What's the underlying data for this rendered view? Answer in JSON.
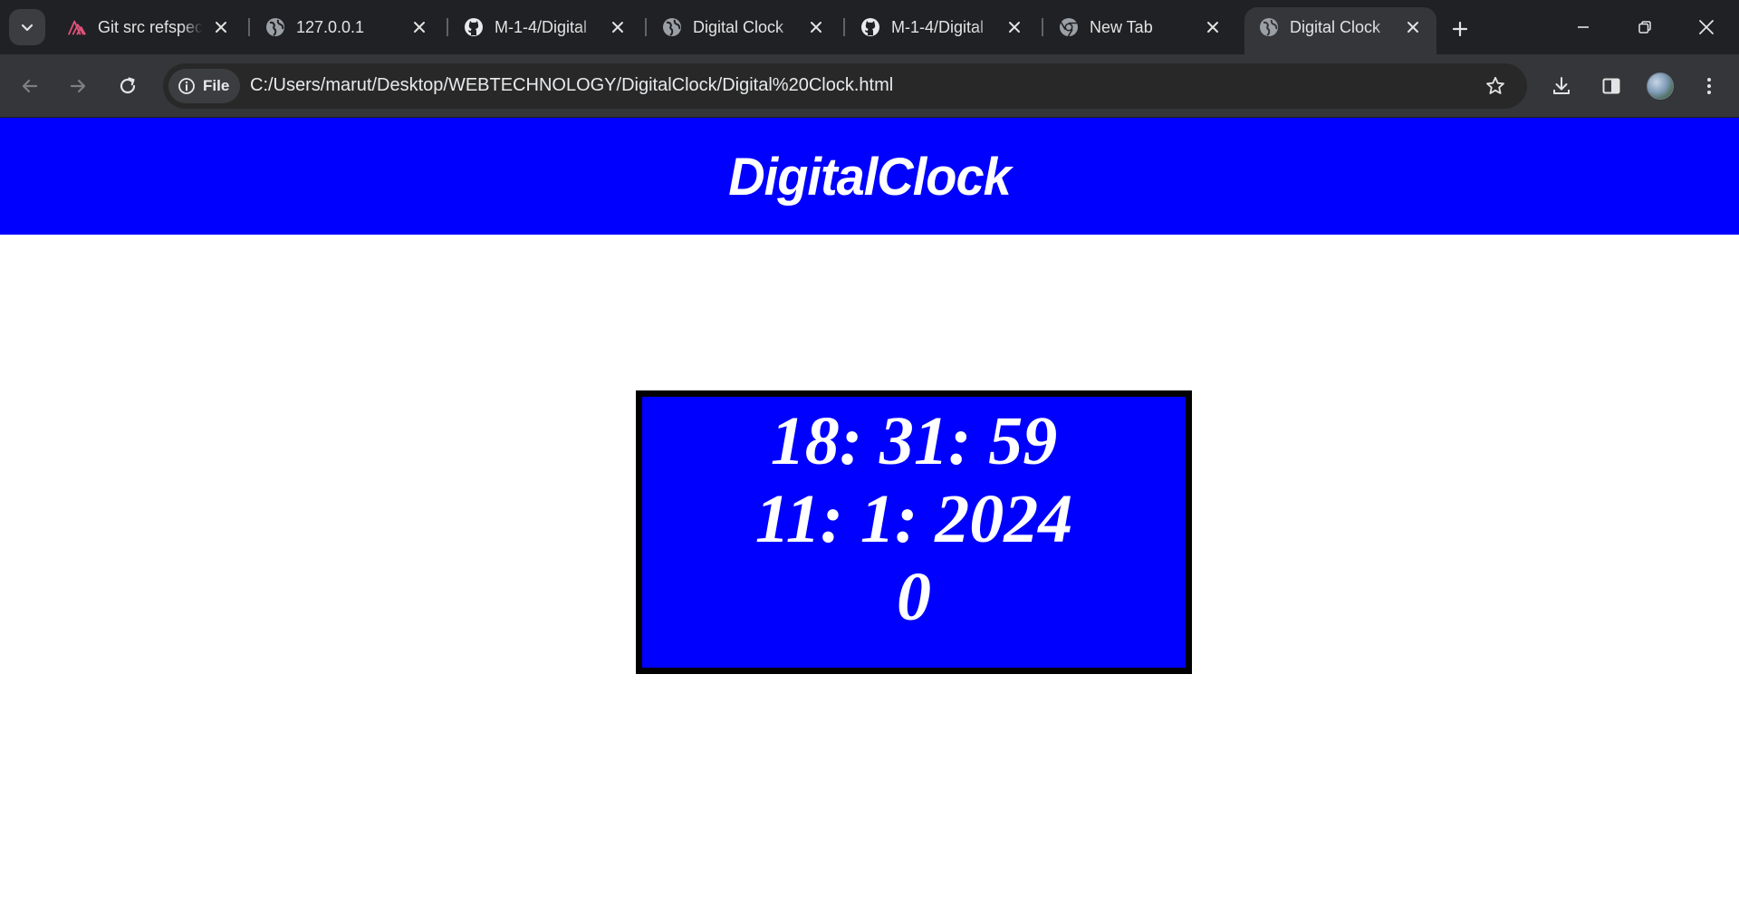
{
  "browser": {
    "tabs": [
      {
        "title": "Git src refspec",
        "icon": "git-refspec-icon",
        "active": false
      },
      {
        "title": "127.0.0.1",
        "icon": "globe-icon",
        "active": false
      },
      {
        "title": "M-1-4/Digital",
        "icon": "github-icon",
        "active": false
      },
      {
        "title": "Digital Clock",
        "icon": "globe-icon",
        "active": false
      },
      {
        "title": "M-1-4/Digital",
        "icon": "github-icon",
        "active": false
      },
      {
        "title": "New Tab",
        "icon": "chrome-icon",
        "active": false
      },
      {
        "title": "Digital Clock",
        "icon": "globe-icon",
        "active": true
      }
    ],
    "address": {
      "chip_label": "File",
      "url": "C:/Users/marut/Desktop/WEBTECHNOLOGY/DigitalClock/Digital%20Clock.html"
    },
    "colors": {
      "tabstrip": "#202124",
      "toolbar": "#35363a",
      "omnibox": "#282828"
    }
  },
  "page": {
    "header": {
      "title": "DigitalClock"
    },
    "clock": {
      "time": "18: 31: 59",
      "date": "11: 1: 2024",
      "extra": "0"
    },
    "colors": {
      "header_bg": "#0000ff",
      "clock_bg": "#0000ff",
      "clock_border": "#000000",
      "text": "#ffffff"
    }
  }
}
